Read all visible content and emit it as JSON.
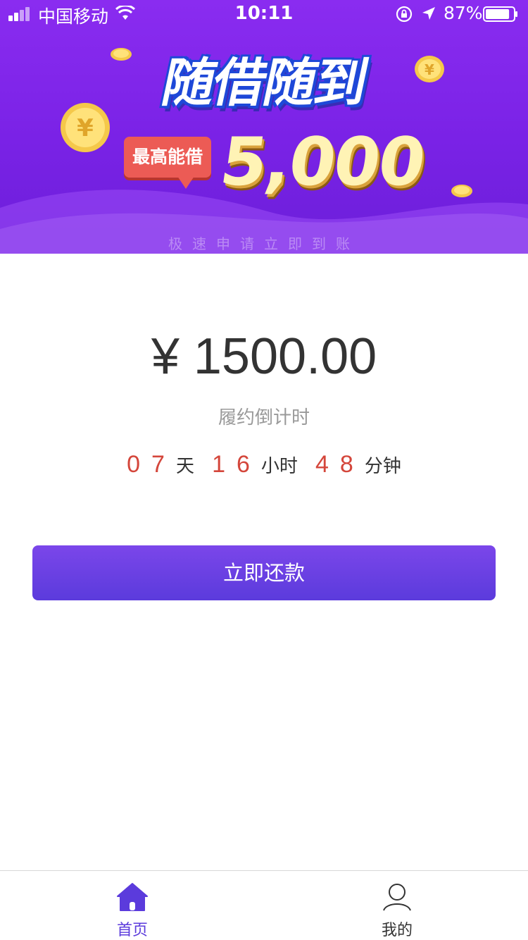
{
  "status_bar": {
    "carrier": "中国移动",
    "time": "10:11",
    "battery_percent": "87%",
    "battery_level": 0.87,
    "icons": [
      "signal-icon",
      "wifi-icon",
      "rotation-lock-icon",
      "location-arrow-icon",
      "battery-icon"
    ]
  },
  "banner": {
    "headline": "随借随到",
    "tag": "最高能借",
    "max_amount": "5,000",
    "slogan": "极速申请立即到账",
    "colors": {
      "background": "#7a22e6",
      "tag": "#ec5b55",
      "amount_gold": "#fff3b5"
    }
  },
  "loan": {
    "amount": "¥ 1500.00",
    "countdown_label": "履约倒计时",
    "countdown": {
      "days": "07",
      "days_unit": "天",
      "hours": "16",
      "hours_unit": "小时",
      "minutes": "48",
      "minutes_unit": "分钟"
    },
    "repay_button": "立即还款"
  },
  "tab_bar": {
    "tabs": [
      {
        "label": "首页",
        "icon": "home-icon",
        "active": true
      },
      {
        "label": "我的",
        "icon": "user-icon",
        "active": false
      }
    ],
    "colors": {
      "active": "#5b3bdc",
      "inactive": "#333333"
    }
  }
}
